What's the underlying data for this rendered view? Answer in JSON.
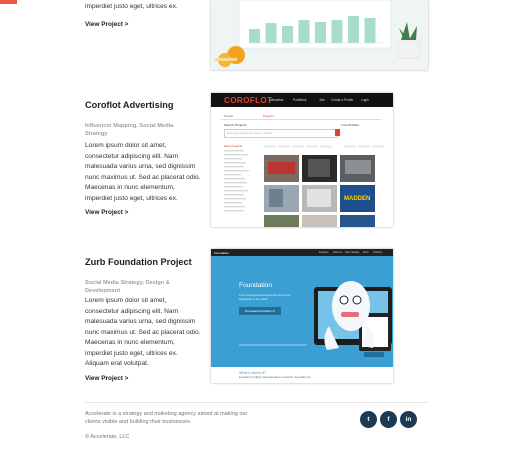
{
  "top_project": {
    "description_tail": "imperdiet justo eget, ultrices ex.",
    "link": "View Project >"
  },
  "projects": [
    {
      "title": "Coroflot Advertising",
      "subtitle_line1": "Influencer Mapping, Social Media",
      "subtitle_line2": "Strategy",
      "body": [
        "Lorem ipsum dolor sit amet,",
        "consectetur adipiscing elit. Nam",
        "malesuada varius urna, sed dignissim",
        "nunc maximus ut. Sed ac placerat odio.",
        "Maecenas in nunc elementum,",
        "imperdiet justo eget, ultrices ex."
      ],
      "link": "View Project >"
    },
    {
      "title": "Zurb Foundation Project",
      "subtitle_line1": "Social Media Strategy, Design &",
      "subtitle_line2": "Development",
      "body": [
        "Lorem ipsum dolor sit amet,",
        "consectetur adipiscing elit. Nam",
        "malesuada varius urna, sed dignissim",
        "nunc maximus ut. Sed ac placerat odio.",
        "Maecenas in nunc elementum,",
        "imperdiet justo eget, ultrices ex.",
        "Aliquam erat volutpat."
      ],
      "link": "View Project >"
    }
  ],
  "coroflot_shot": {
    "logo": "COROFLOT",
    "nav": [
      "Jobseeker",
      "Portfolios",
      "Join",
      "Create a Profile",
      "Login"
    ],
    "tabs": [
      "People",
      "Projects"
    ],
    "search_label": "Search Projects",
    "search_placeholder": "Enter project keyword, name or location",
    "side_head": "Most Projects",
    "right_title": "Lost Profiles"
  },
  "zurb_shot": {
    "brand": "Foundation",
    "nav": [
      "Features",
      "Add-ons",
      "Case Studies",
      "Docs",
      "Training"
    ],
    "title": "Foundation",
    "tagline": "The most advanced responsive front-end framework in the world.",
    "button": "Download Foundation 6",
    "footer_heading": "What's new in 6?",
    "footer_text": "Foundation 6 is lighter, faster and easier to customize. See what's new."
  },
  "footer": {
    "about_line1": "Accelerate is a strategy and maketing agency aimed at making our",
    "about_line2": "clients visible and building their businesses.",
    "copyright": "© Accelerate, LLC",
    "social": [
      {
        "icon": "twitter-icon",
        "glyph": "t"
      },
      {
        "icon": "facebook-icon",
        "glyph": "f"
      },
      {
        "icon": "linkedin-icon",
        "glyph": "in"
      }
    ]
  },
  "colors": {
    "accent": "#ec5a46",
    "social_bg": "#1f3a53",
    "chart_bars": "#a8dccc",
    "zurb_blue": "#3b9fd4",
    "coroflot_red": "#e0412b"
  }
}
